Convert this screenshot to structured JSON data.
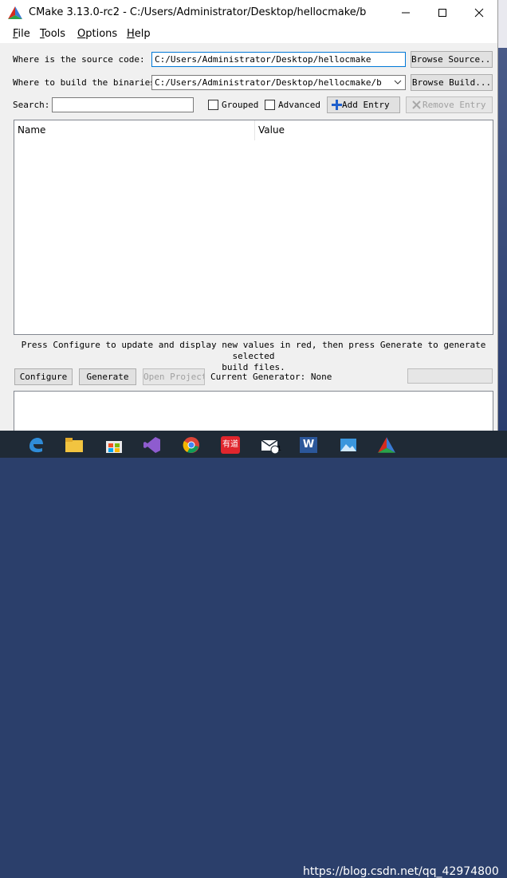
{
  "window": {
    "title": "CMake 3.13.0-rc2 - C:/Users/Administrator/Desktop/hellocmake/b"
  },
  "menu": [
    {
      "key": "F",
      "rest": "ile"
    },
    {
      "key": "T",
      "rest": "ools"
    },
    {
      "key": "O",
      "rest": "ptions"
    },
    {
      "key": "H",
      "rest": "elp"
    }
  ],
  "source": {
    "label": "Where is the source code:",
    "value": "C:/Users/Administrator/Desktop/hellocmake",
    "browse_label": "Browse Source..."
  },
  "build": {
    "label": "Where to build the binaries:",
    "value": "C:/Users/Administrator/Desktop/hellocmake/b",
    "browse_label": "Browse Build..."
  },
  "search": {
    "label": "Search:",
    "value": ""
  },
  "options": {
    "grouped_label": "Grouped",
    "grouped_checked": false,
    "advanced_label": "Advanced",
    "advanced_checked": false
  },
  "toolbar": {
    "add_entry_label": "Add Entry",
    "remove_entry_label": "Remove Entry"
  },
  "table": {
    "columns": [
      "Name",
      "Value"
    ],
    "rows": []
  },
  "hint": {
    "line1": "Press Configure to update and display new values in red, then press Generate to generate selected",
    "line2": "build files."
  },
  "actions": {
    "configure_label": "Configure",
    "generate_label": "Generate",
    "open_project_label": "Open Project",
    "current_generator": "Current Generator: None"
  },
  "taskbar": {
    "icons": [
      "edge-icon",
      "file-explorer-icon",
      "store-icon",
      "visual-studio-icon",
      "chrome-icon",
      "youdao-icon",
      "mail-icon",
      "word-icon",
      "photos-icon",
      "cmake-icon"
    ],
    "youdao_text": "有道",
    "mail_badge": "1",
    "watermark": "https://blog.csdn.net/qq_42974800"
  },
  "colors": {
    "accent": "#0078d7",
    "taskbar": "#1f2a36"
  }
}
